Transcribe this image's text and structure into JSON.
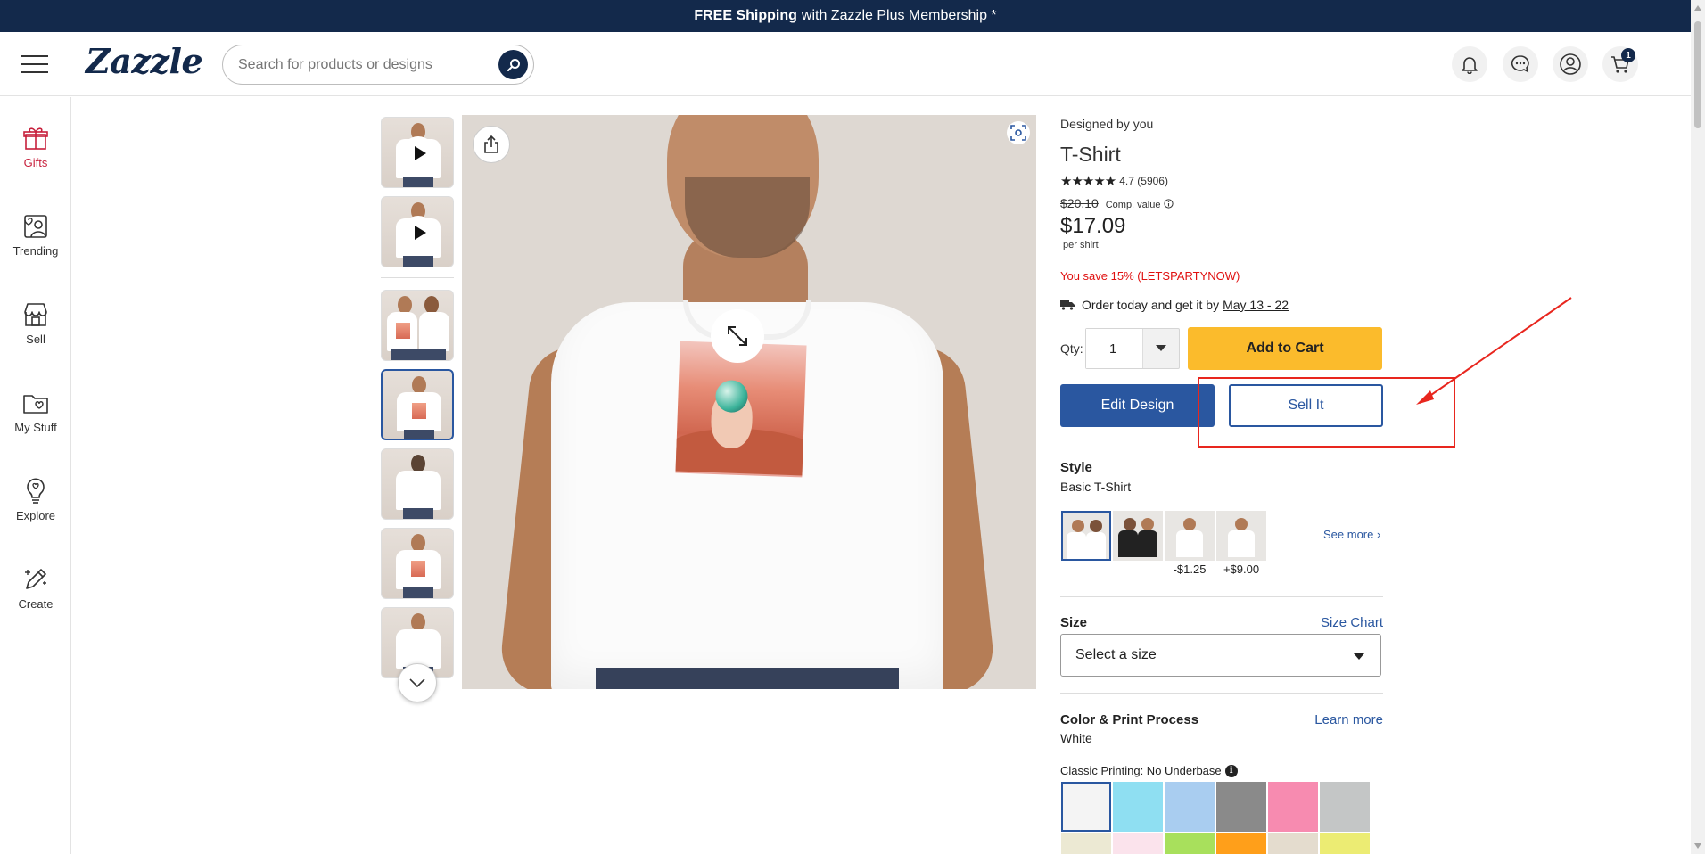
{
  "promo": {
    "bold": "FREE Shipping",
    "rest": "with Zazzle Plus Membership *"
  },
  "header": {
    "logo": "Zazzle",
    "search_placeholder": "Search for products or designs",
    "cart_count": "1"
  },
  "sidebar": {
    "items": [
      {
        "label": "Gifts",
        "icon": "gift-icon"
      },
      {
        "label": "Trending",
        "icon": "trending-icon"
      },
      {
        "label": "Sell",
        "icon": "store-icon"
      },
      {
        "label": "My Stuff",
        "icon": "folder-icon"
      },
      {
        "label": "Explore",
        "icon": "lightbulb-icon"
      },
      {
        "label": "Create",
        "icon": "pen-sparkle-icon"
      }
    ]
  },
  "product": {
    "designed_by": "Designed by you",
    "title": "T-Shirt",
    "rating": "4.7",
    "review_count": "(5906)",
    "old_price": "$20.10",
    "comp_value": "Comp. value",
    "price": "$17.09",
    "per_unit": "per shirt",
    "savings": "You save 15% (LETSPARTYNOW)",
    "delivery_text": "Order today and get it by",
    "delivery_dates": "May 13 - 22",
    "qty_label": "Qty:",
    "qty_value": "1",
    "add_to_cart": "Add to Cart",
    "edit_design": "Edit Design",
    "sell_it": "Sell It"
  },
  "style": {
    "heading": "Style",
    "selected": "Basic T-Shirt",
    "swatches": [
      {
        "price": ""
      },
      {
        "price": ""
      },
      {
        "price": "-$1.25"
      },
      {
        "price": "+$9.00"
      }
    ],
    "see_more": "See more ›"
  },
  "size": {
    "heading": "Size",
    "chart_link": "Size Chart",
    "placeholder": "Select a size"
  },
  "color": {
    "heading": "Color & Print Process",
    "learn_more": "Learn more",
    "selected": "White",
    "print_process": "Classic Printing: No Underbase",
    "swatches_row1": [
      "#f4f4f4",
      "#8fdff2",
      "#a9cdf0",
      "#8a8a8a",
      "#f78bb0",
      "#c4c6c6"
    ],
    "swatches_row2": [
      "#ece9d3",
      "#fbe3ec",
      "#a8e05c",
      "#ff9f1a",
      "#e4dcce",
      "#ecec73"
    ]
  },
  "colors": {
    "navy": "#13294b",
    "accent_blue": "#2a57a0",
    "cart_yellow": "#fbbb2c",
    "sale_red": "#e01010",
    "annotation_red": "#e8261e"
  }
}
